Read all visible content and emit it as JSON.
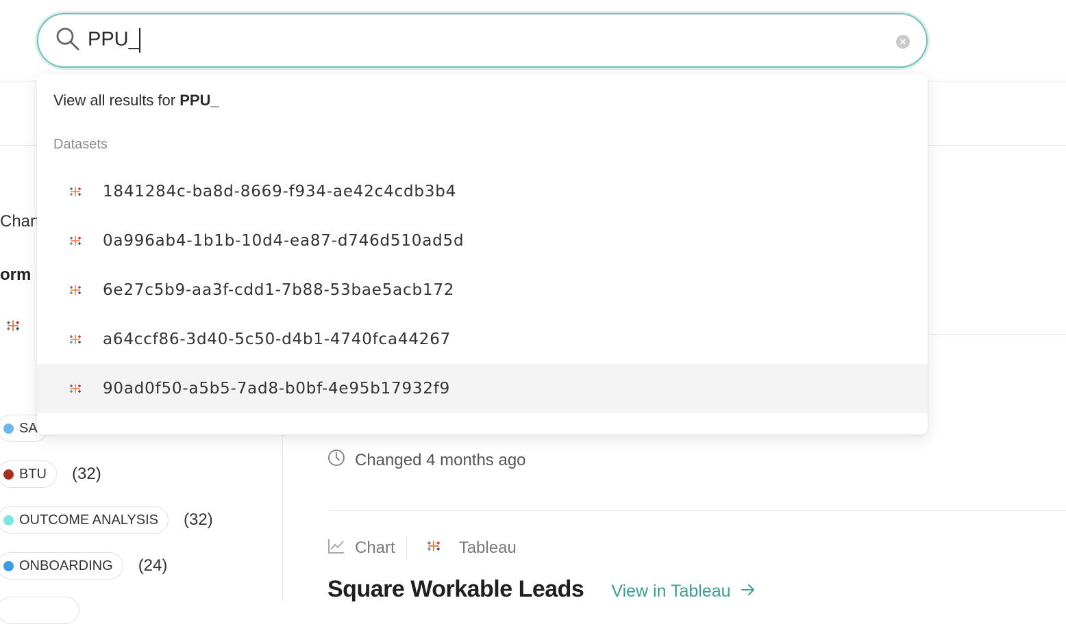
{
  "search": {
    "query": "PPU_",
    "placeholder": ""
  },
  "dropdown": {
    "view_all_prefix": "View all results for ",
    "view_all_query": "PPU_",
    "section_label": "Datasets",
    "results": [
      {
        "label": "1841284c-ba8d-8669-f934-ae42c4cdb3b4",
        "icon": "tableau-icon"
      },
      {
        "label": "0a996ab4-1b1b-10d4-ea87-d746d510ad5d",
        "icon": "tableau-icon"
      },
      {
        "label": "6e27c5b9-aa3f-cdd1-7b88-53bae5acb172",
        "icon": "tableau-icon"
      },
      {
        "label": "a64ccf86-3d40-5c50-d4b1-4740fca44267",
        "icon": "tableau-icon"
      },
      {
        "label": "90ad0f50-a5b5-7ad8-b0bf-4e95b17932f9",
        "icon": "tableau-icon",
        "highlighted": true
      }
    ]
  },
  "background": {
    "chart_fragment": "Chart",
    "form_fragment": "orm",
    "tags": [
      {
        "label": "SA",
        "count": "",
        "color": "#6fb6ea"
      },
      {
        "label": "BTU",
        "count": "(32)",
        "color": "#a5311f"
      },
      {
        "label": "OUTCOME ANALYSIS",
        "count": "(32)",
        "color": "#7fe6e6"
      },
      {
        "label": "ONBOARDING",
        "count": "(24)",
        "color": "#3d9be9"
      }
    ],
    "changed_text": "Changed 4 months ago",
    "meta_type": "Chart",
    "meta_source": "Tableau",
    "title": "Square Workable Leads",
    "view_link": "View in Tableau"
  },
  "colors": {
    "accent": "#6cc0b5",
    "link": "#3a9f94"
  }
}
